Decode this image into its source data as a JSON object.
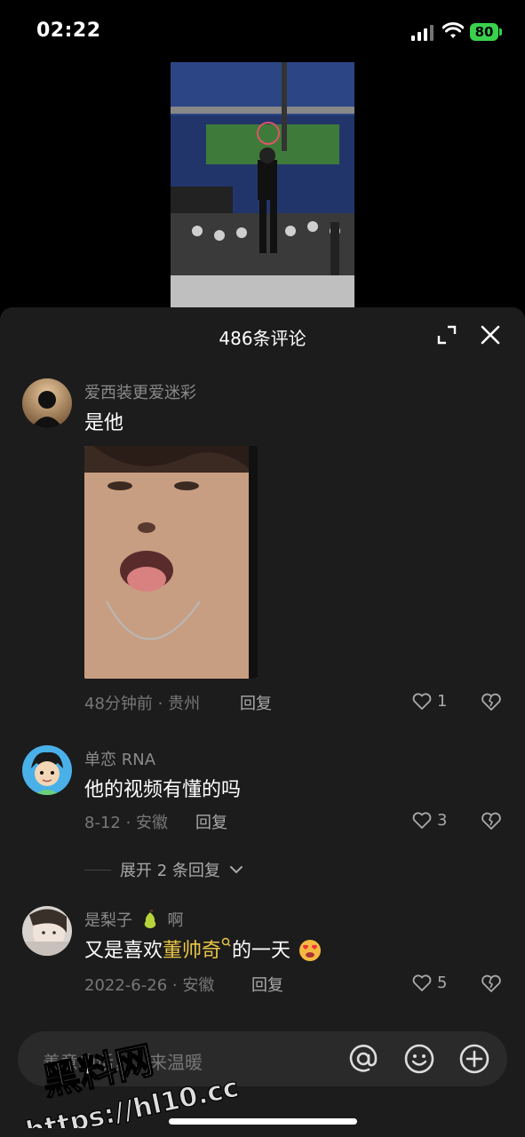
{
  "status_bar": {
    "time": "02:22",
    "battery": "80"
  },
  "sheet": {
    "title": "486条评论"
  },
  "comments": [
    {
      "username": "爱西装更爱迷彩",
      "text": "是他",
      "time_location": "48分钟前 · 贵州",
      "reply_label": "回复",
      "likes": "1"
    },
    {
      "username": "单恋 RNA",
      "text": "他的视频有懂的吗",
      "time_location": "8-12 · 安徽",
      "reply_label": "回复",
      "likes": "3",
      "expand_replies": "展开 2 条回复"
    },
    {
      "username": "是梨子",
      "username_suffix": "啊",
      "text_before": "又是喜欢",
      "text_highlight": "董帅奇",
      "text_after": "的一天",
      "time_location": "2022-6-26 · 安徽",
      "reply_label": "回复",
      "likes": "5"
    }
  ],
  "input": {
    "placeholder": "善意的话，人来温暖"
  },
  "watermark": {
    "line1": "黑料网",
    "line2": "https://hl10.cc"
  },
  "colors": {
    "sheet_bg": "#1c1c1c",
    "highlight": "#e9c547",
    "battery": "#3ad14d"
  }
}
